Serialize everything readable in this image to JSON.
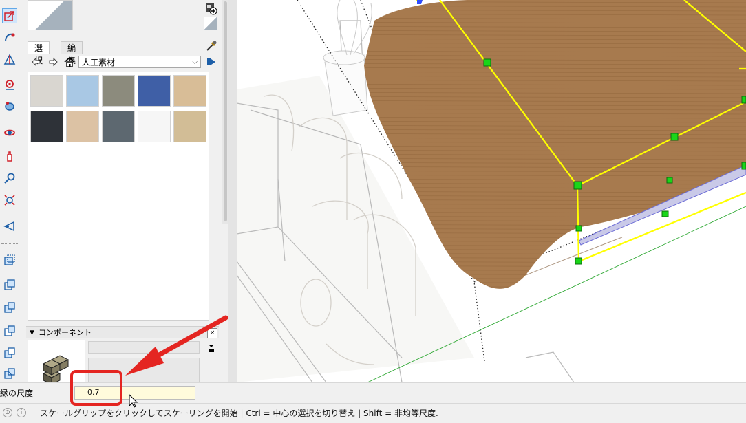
{
  "materials_panel": {
    "tabs": [
      "選択",
      "編集"
    ],
    "active_tab": "選択",
    "library_select": "人工素材",
    "swatches": [
      {
        "name": "light-gray",
        "color": "#d9d6d0"
      },
      {
        "name": "light-blue",
        "color": "#a9c8e4"
      },
      {
        "name": "gray-green",
        "color": "#8c8b7d"
      },
      {
        "name": "blue",
        "color": "#3f5fa6"
      },
      {
        "name": "tan",
        "color": "#d8bd97"
      },
      {
        "name": "charcoal",
        "color": "#2e3238"
      },
      {
        "name": "wood-light",
        "color": "#dcc2a4"
      },
      {
        "name": "slate",
        "color": "#5d6870"
      },
      {
        "name": "white",
        "color": "#f6f6f6"
      },
      {
        "name": "beige",
        "color": "#d2bd96"
      }
    ]
  },
  "components_panel": {
    "title": "コンポーネント",
    "collapse_icon": "triangle-down-icon",
    "close_label": "×"
  },
  "measurements": {
    "label": "縁の尺度",
    "value": "0.7"
  },
  "status_bar": {
    "text": "スケールグリップをクリックしてスケーリングを開始 | Ctrl = 中心の選択を切り替え | Shift = 非均等尺度."
  },
  "colors": {
    "selection": "#ffff00",
    "grip": "#00e000",
    "bedspread": "#a77a4e",
    "annotation": "#e42521"
  }
}
